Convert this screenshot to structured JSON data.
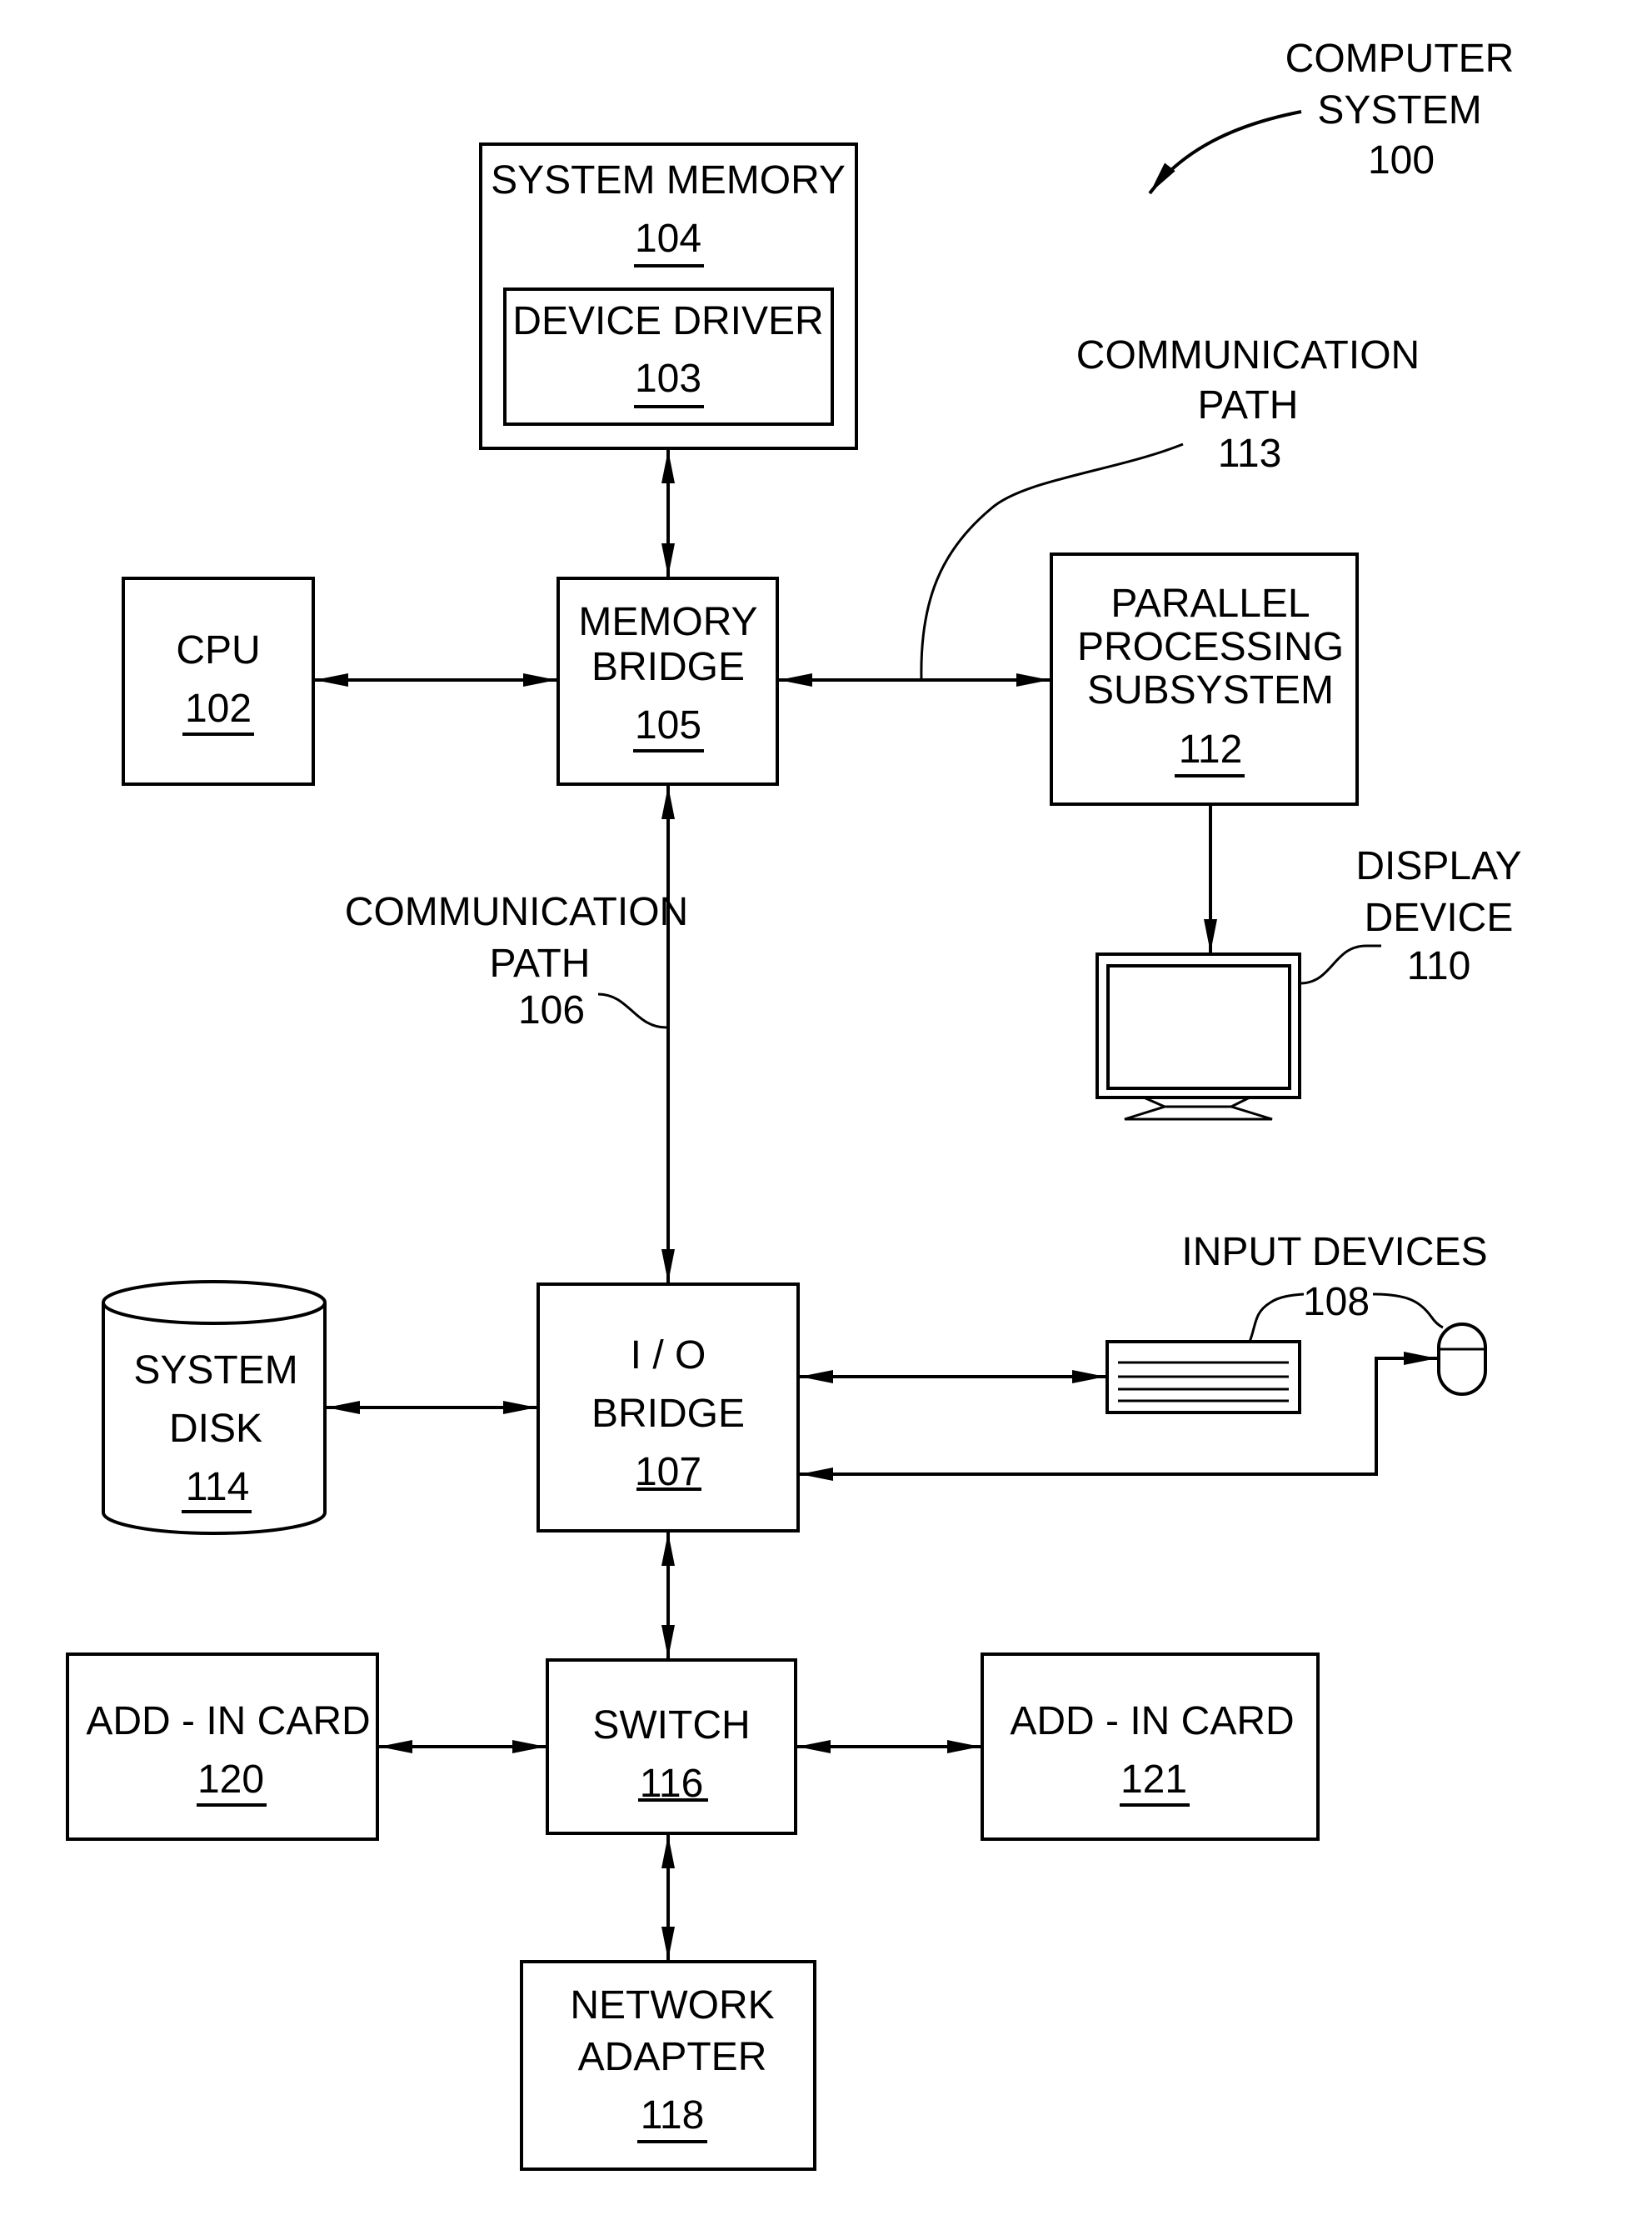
{
  "figure": {
    "title_lines": [
      "COMPUTER",
      "SYSTEM",
      "100"
    ]
  },
  "blocks": {
    "system_memory": {
      "label_lines": [
        "SYSTEM MEMORY"
      ],
      "ref": "104"
    },
    "device_driver": {
      "label_lines": [
        "DEVICE DRIVER"
      ],
      "ref": "103"
    },
    "cpu": {
      "label_lines": [
        "CPU"
      ],
      "ref": "102"
    },
    "memory_bridge": {
      "label_lines": [
        "MEMORY",
        "BRIDGE"
      ],
      "ref": "105"
    },
    "parallel_processing": {
      "label_lines": [
        "PARALLEL",
        "PROCESSING",
        "SUBSYSTEM"
      ],
      "ref": "112"
    },
    "display_device": {
      "label_lines": [
        "DISPLAY",
        "DEVICE"
      ],
      "ref": "110"
    },
    "io_bridge": {
      "label_lines": [
        "I / O",
        "BRIDGE"
      ],
      "ref": "107"
    },
    "system_disk": {
      "label_lines": [
        "SYSTEM",
        "DISK"
      ],
      "ref": "114"
    },
    "input_devices": {
      "label_lines": [
        "INPUT  DEVICES"
      ],
      "ref": "108"
    },
    "switch": {
      "label_lines": [
        "SWITCH"
      ],
      "ref": "116"
    },
    "addin_card_120": {
      "label_lines": [
        "ADD - IN CARD"
      ],
      "ref": "120"
    },
    "addin_card_121": {
      "label_lines": [
        "ADD - IN CARD"
      ],
      "ref": "121"
    },
    "network_adapter": {
      "label_lines": [
        "NETWORK",
        "ADAPTER"
      ],
      "ref": "118"
    }
  },
  "paths": {
    "path_113": {
      "label_lines": [
        "COMMUNICATION",
        "PATH"
      ],
      "ref": "113"
    },
    "path_106": {
      "label_lines": [
        "COMMUNICATION",
        "PATH"
      ],
      "ref": "106"
    }
  },
  "connections": [
    {
      "from": "system_memory",
      "to": "memory_bridge",
      "type": "bidirectional"
    },
    {
      "from": "cpu",
      "to": "memory_bridge",
      "type": "bidirectional"
    },
    {
      "from": "memory_bridge",
      "to": "parallel_processing",
      "type": "bidirectional",
      "via": "path_113"
    },
    {
      "from": "parallel_processing",
      "to": "display_device",
      "type": "directed"
    },
    {
      "from": "memory_bridge",
      "to": "io_bridge",
      "type": "bidirectional",
      "via": "path_106"
    },
    {
      "from": "system_disk",
      "to": "io_bridge",
      "type": "bidirectional"
    },
    {
      "from": "io_bridge",
      "to": "input_devices_keyboard",
      "type": "bidirectional"
    },
    {
      "from": "input_devices_mouse",
      "to": "io_bridge",
      "type": "directed"
    },
    {
      "from": "io_bridge",
      "to": "switch",
      "type": "bidirectional"
    },
    {
      "from": "addin_card_120",
      "to": "switch",
      "type": "bidirectional"
    },
    {
      "from": "switch",
      "to": "addin_card_121",
      "type": "bidirectional"
    },
    {
      "from": "switch",
      "to": "network_adapter",
      "type": "bidirectional"
    }
  ]
}
